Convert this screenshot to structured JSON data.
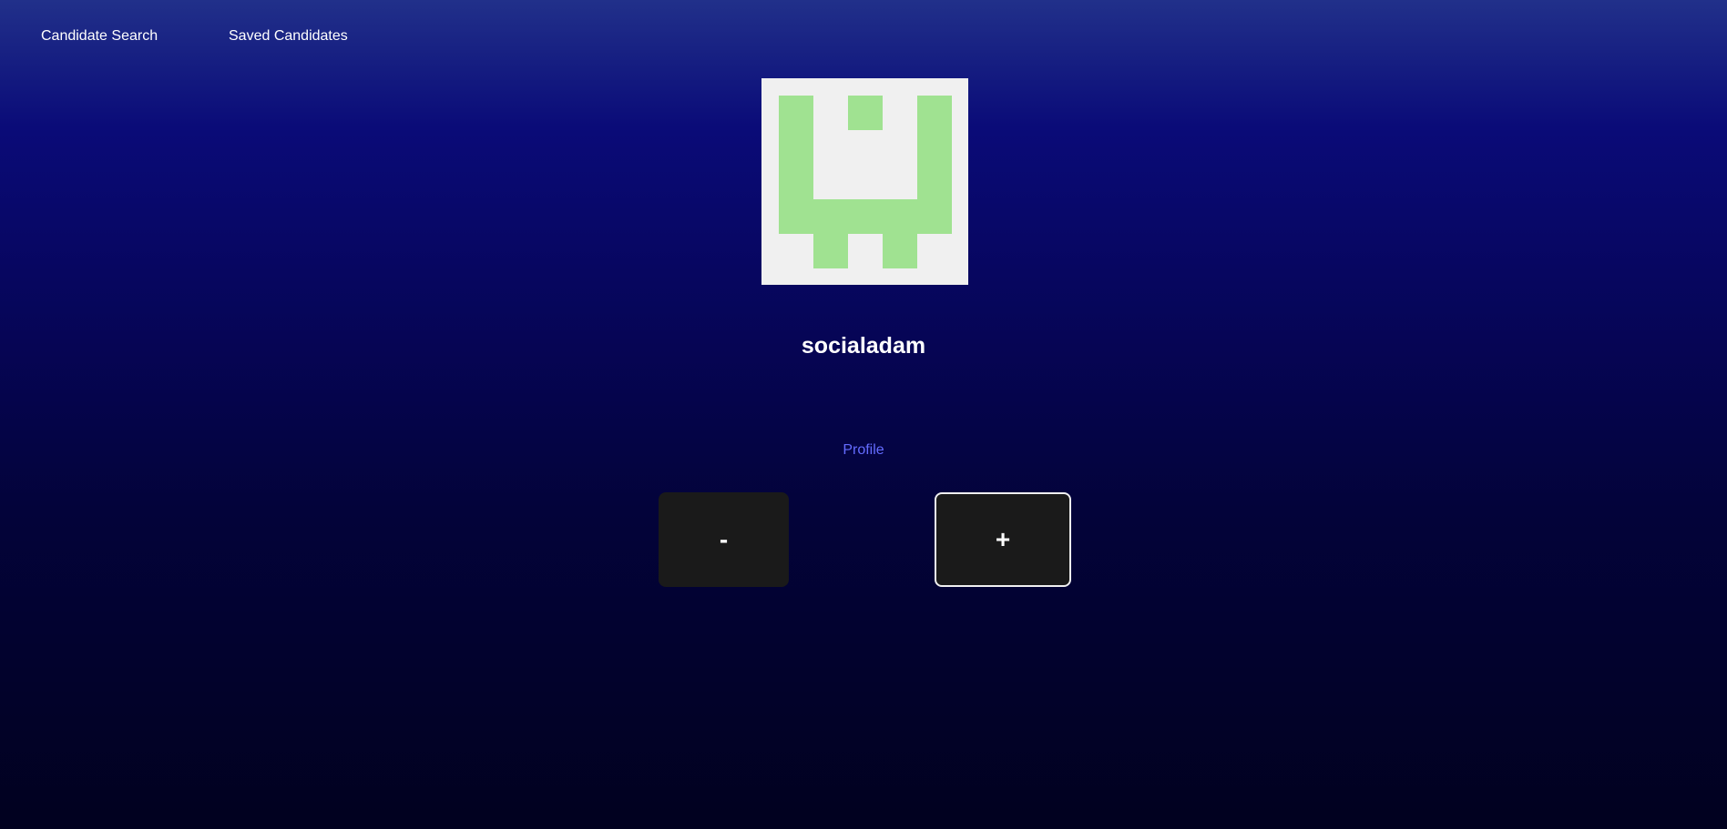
{
  "nav": {
    "items": [
      {
        "label": "Candidate Search"
      },
      {
        "label": "Saved Candidates"
      }
    ]
  },
  "candidate": {
    "username": "socialadam",
    "profile_link_label": "Profile",
    "avatar": {
      "kind": "identicon",
      "background_color": "#f0f0f0",
      "foreground_color": "#a0e291"
    }
  },
  "actions": {
    "reject_label": "-",
    "accept_label": "+"
  },
  "colors": {
    "link": "#646cff",
    "button_bg": "#1a1a1a",
    "text": "#ffffff"
  }
}
